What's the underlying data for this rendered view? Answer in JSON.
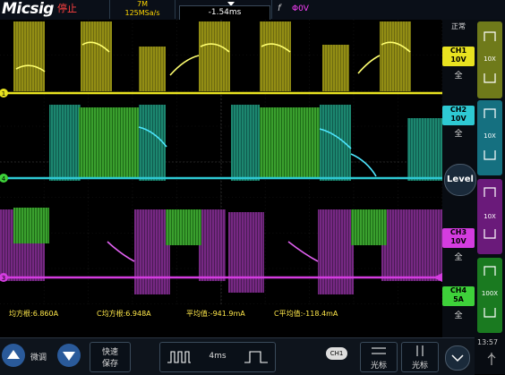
{
  "header": {
    "logo": "Micsig",
    "status": "停止",
    "memory_depth": "7M",
    "sample_rate": "125MSa/s",
    "time_offset": "-1.54ms",
    "trigger_slope_symbol": "f",
    "trigger_level": "Φ0V"
  },
  "right_panel": {
    "mode": "正常",
    "level_button": "Level",
    "channels": [
      {
        "id": "CH1",
        "scale": "10V",
        "coupling": "全",
        "probe": "10X",
        "color": "#d7d21e"
      },
      {
        "id": "CH2",
        "scale": "10V",
        "coupling": "全",
        "probe": "10X",
        "color": "#2ec9d3"
      },
      {
        "id": "CH3",
        "scale": "10V",
        "coupling": "全",
        "probe": "10X",
        "color": "#c43ccf"
      },
      {
        "id": "CH4",
        "scale": "5A",
        "coupling": "全",
        "probe": "100X",
        "color": "#3ed13a"
      }
    ]
  },
  "traces": {
    "markers": [
      "1",
      "4",
      "3"
    ]
  },
  "measurements": [
    {
      "label": "均方根:",
      "value": "6.860A"
    },
    {
      "label": "C均方根:",
      "value": "6.948A"
    },
    {
      "label": "平均值:",
      "value": "-941.9mA"
    },
    {
      "label": "C平均值:",
      "value": "-118.4mA"
    }
  ],
  "bottom": {
    "fine_label": "微调",
    "quick_save": [
      "快速",
      "保存"
    ],
    "timebase": "4ms",
    "channel_badge": "CH1",
    "cursor_label_1": "光标",
    "cursor_label_2": "光标",
    "clock": "13:57"
  }
}
